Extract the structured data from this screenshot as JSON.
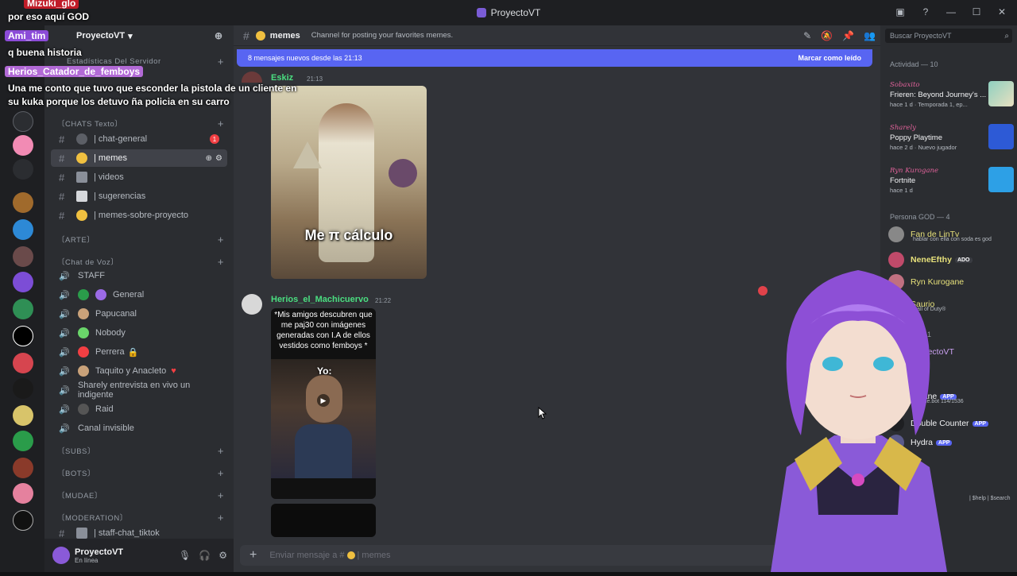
{
  "window": {
    "title": "ProyectoVT"
  },
  "overlay_chat": [
    {
      "name": "Mizuki_glo",
      "name_bg": "#c01c28",
      "text": "por eso aquí GOD"
    },
    {
      "name": "Ami_tim",
      "name_bg": "#8b4bd8",
      "text": "q buena historia"
    },
    {
      "name": "Herios_Catador_de_femboys",
      "name_bg": "#b26ad6",
      "text": "Una me conto que tuvo que esconder la pistola de un cliente en su kuka porque los detuvo ña policia en su carro"
    }
  ],
  "server": {
    "name": "ProyectoVT",
    "stats_channel": "Estadísticas Del Servidor"
  },
  "categories": {
    "chats": "〔CHATS Texto〕",
    "arte": "〔ARTE〕",
    "voz": "〔Chat de Voz〕",
    "subs": "〔SUBS〕",
    "bots": "〔BOTS〕",
    "mudae": "〔MUDAE〕",
    "moderation": "〔MODERATION〕"
  },
  "text_channels": [
    {
      "name": "| chat-general",
      "badge": "1"
    },
    {
      "name": "| memes"
    },
    {
      "name": "| videos"
    },
    {
      "name": "| sugerencias"
    },
    {
      "name": "| memes-sobre-proyecto"
    }
  ],
  "voice_channels": [
    "STAFF",
    "General",
    "Papucanal",
    "Nobody",
    "Perrera",
    "Taquito y Anacleto",
    "Sharely entrevista en vivo un indigente",
    "Raid",
    "Canal invisible"
  ],
  "mod_channel": "| staff-chat_tiktok",
  "user": {
    "name": "ProyectoVT",
    "status": "En línea"
  },
  "chat": {
    "channel_name": "memes",
    "topic": "Channel for posting your favorites memes.",
    "new_messages_text": "8 mensajes nuevos desde las 21:13",
    "mark_read": "Marcar como leído",
    "msg1_author": "Eskiz",
    "msg1_time": "21:13",
    "meme1_caption": "Me π cálculo",
    "msg2_author": "Herios_el_Machicuervo",
    "msg2_time": "21:22",
    "meme2_caption": "*Mis amigos descubren que me paj30 con imágenes generadas con I.A de ellos vestidos como femboys *",
    "meme2_yo": "Yo:",
    "composer_placeholder": "Enviar mensaje a #",
    "composer_channel": "| memes"
  },
  "right_panel": {
    "search_placeholder": "Buscar ProyectoVT",
    "activity_title": "Actividad — 10",
    "activities": [
      {
        "who": "Sobaxito",
        "game": "Frieren: Beyond Journey's ...",
        "meta": "hace 1 d  ·  Temporada 1, ep..."
      },
      {
        "who": "Sharely",
        "game": "Poppy Playtime",
        "meta": "hace 2 d  ·  Nuevo jugador"
      },
      {
        "who": "Ryn Kurogane",
        "game": "Fortnite",
        "meta": "hace 1 d"
      }
    ],
    "group_god": "Persona GOD — 4",
    "members_god": [
      {
        "name": "Fan de LinTv",
        "sub": "hablar con ella con soda es god"
      },
      {
        "name": "NeneEfthy",
        "tag": "ADO"
      },
      {
        "name": "Ryn Kurogane"
      },
      {
        "name": "Saurio",
        "sub": "Call of Duty®"
      }
    ],
    "group_2": "—1",
    "member_pvt": "ProyectoVT",
    "bots": [
      {
        "name": "Arcane",
        "tag": "APP",
        "sub": "arcane.bot 114/1536"
      },
      {
        "name": "Double Counter",
        "tag": "APP"
      },
      {
        "name": "Hydra",
        "tag": "APP"
      }
    ],
    "bot_extra": "| $help | $search"
  },
  "colors": {
    "accent": "#5865f2",
    "online": "#23a55a",
    "alert": "#f23f43"
  }
}
